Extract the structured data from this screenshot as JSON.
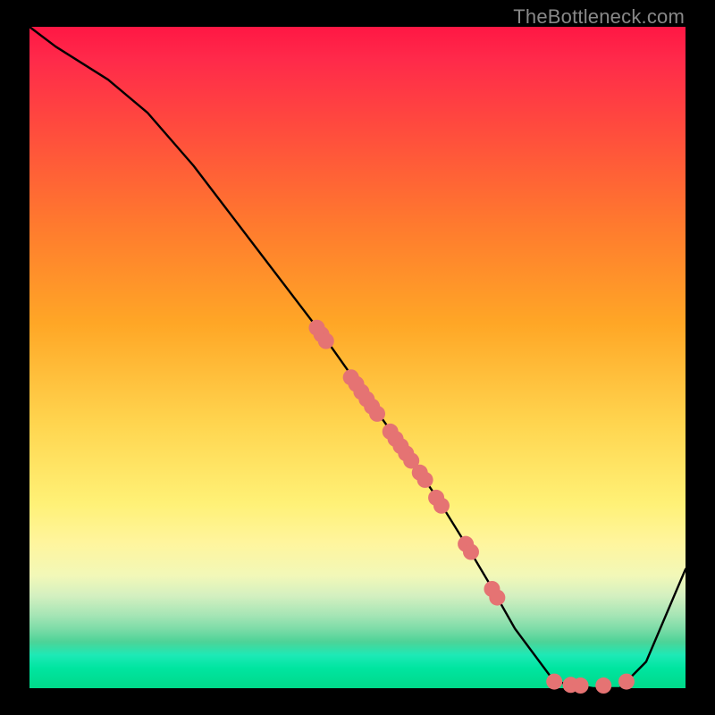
{
  "watermark": "TheBottleneck.com",
  "chart_data": {
    "type": "line",
    "title": "",
    "xlabel": "",
    "ylabel": "",
    "xlim": [
      0,
      100
    ],
    "ylim": [
      0,
      100
    ],
    "grid": false,
    "legend": false,
    "series": [
      {
        "name": "bottleneck-curve",
        "color": "#000000",
        "x": [
          0,
          4,
          8,
          12,
          18,
          25,
          35,
          45,
          55,
          62,
          67,
          70,
          74,
          80,
          86,
          90,
          94,
          100
        ],
        "y": [
          100,
          97,
          94.5,
          92,
          87,
          79,
          66,
          53,
          39,
          29,
          21,
          16,
          9,
          1,
          0,
          0,
          4,
          18
        ]
      }
    ],
    "scatter_points": {
      "name": "highlight-points",
      "color": "#e57373",
      "radius_px": 9,
      "points": [
        {
          "x": 43.8,
          "y": 54.5
        },
        {
          "x": 44.5,
          "y": 53.5
        },
        {
          "x": 45.2,
          "y": 52.5
        },
        {
          "x": 49.0,
          "y": 47.0
        },
        {
          "x": 49.8,
          "y": 46.0
        },
        {
          "x": 50.6,
          "y": 44.8
        },
        {
          "x": 51.4,
          "y": 43.7
        },
        {
          "x": 52.2,
          "y": 42.6
        },
        {
          "x": 53.0,
          "y": 41.5
        },
        {
          "x": 55.0,
          "y": 38.8
        },
        {
          "x": 55.8,
          "y": 37.7
        },
        {
          "x": 56.6,
          "y": 36.6
        },
        {
          "x": 57.4,
          "y": 35.5
        },
        {
          "x": 58.2,
          "y": 34.4
        },
        {
          "x": 59.5,
          "y": 32.6
        },
        {
          "x": 60.3,
          "y": 31.5
        },
        {
          "x": 62.0,
          "y": 28.8
        },
        {
          "x": 62.8,
          "y": 27.6
        },
        {
          "x": 66.5,
          "y": 21.8
        },
        {
          "x": 67.3,
          "y": 20.6
        },
        {
          "x": 70.5,
          "y": 15.0
        },
        {
          "x": 71.3,
          "y": 13.7
        },
        {
          "x": 80.0,
          "y": 1.0
        },
        {
          "x": 82.5,
          "y": 0.5
        },
        {
          "x": 84.0,
          "y": 0.4
        },
        {
          "x": 87.5,
          "y": 0.4
        },
        {
          "x": 91.0,
          "y": 1.0
        }
      ]
    }
  }
}
